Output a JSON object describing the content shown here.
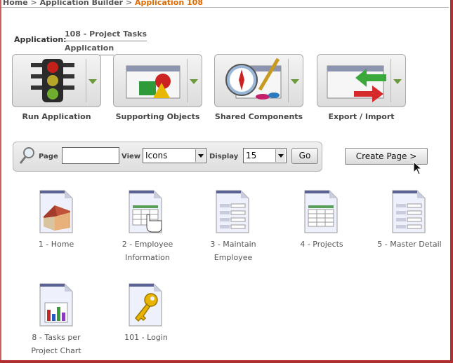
{
  "breadcrumb": {
    "home": "Home",
    "sep1": ">",
    "builder": "Application Builder",
    "sep2": ">",
    "current": "Application 108"
  },
  "application": {
    "label": "Application:",
    "name_line1": "108 - Project Tasks",
    "name_line2": "Application"
  },
  "actions": [
    {
      "label": "Run Application",
      "icon": "traffic-light-icon"
    },
    {
      "label": "Supporting Objects",
      "icon": "shapes-icon"
    },
    {
      "label": "Shared Components",
      "icon": "compass-brush-icon"
    },
    {
      "label": "Export / Import",
      "icon": "export-import-arrows-icon"
    }
  ],
  "search": {
    "page_label": "Page",
    "page_value": "",
    "view_label": "View",
    "view_value": "Icons",
    "display_label": "Display",
    "display_value": "15",
    "go_label": "Go"
  },
  "create_page_label": "Create Page >",
  "pages": [
    {
      "line1": "1 - Home",
      "line2": "",
      "icon": "house-icon"
    },
    {
      "line1": "2 - Employee",
      "line2": "Information",
      "icon": "report-hand-icon"
    },
    {
      "line1": "3 - Maintain",
      "line2": "Employee",
      "icon": "form-icon"
    },
    {
      "line1": "4 - Projects",
      "line2": "",
      "icon": "report-icon"
    },
    {
      "line1": "5 - Master Detail",
      "line2": "",
      "icon": "form-icon"
    },
    {
      "line1": "8 - Tasks per",
      "line2": "Project Chart",
      "icon": "bar-chart-icon"
    },
    {
      "line1": "101 - Login",
      "line2": "",
      "icon": "key-icon"
    }
  ],
  "colors": {
    "breadcrumb_current": "#e06a00",
    "frame": "#b03030",
    "dropdown_arrow": "#6a9a3a"
  }
}
